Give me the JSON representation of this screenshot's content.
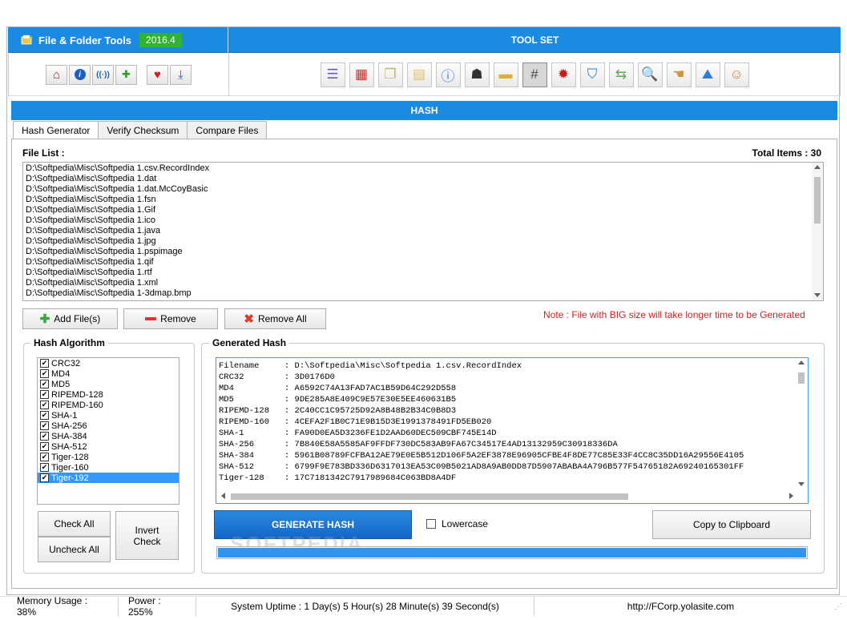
{
  "app": {
    "title": "File & Folder Tools",
    "version": "2016.4",
    "toolset_label": "TOOL SET",
    "colors": {
      "accent": "#1a8be0",
      "badge": "#31b331",
      "note": "#cc2222"
    }
  },
  "left_toolbar": [
    {
      "name": "home-icon",
      "glyph": "⌂",
      "color": "#b01818"
    },
    {
      "name": "info-icon",
      "glyph": "i",
      "color": "#1b5fc0"
    },
    {
      "name": "broadcast-icon",
      "glyph": "((·))",
      "color": "#1b5fc0"
    },
    {
      "name": "add-plus-icon",
      "glyph": "✚",
      "color": "#2f9a2f"
    },
    {
      "name": "heart-icon",
      "glyph": "♥",
      "color": "#d41c2c"
    },
    {
      "name": "download-icon",
      "glyph": "⤓",
      "color": "#1b5fc0"
    }
  ],
  "tool_icons": [
    {
      "name": "document-list-icon",
      "glyph": "☰",
      "color": "#6a58c8"
    },
    {
      "name": "calendar-icon",
      "glyph": "▦",
      "color": "#c83030"
    },
    {
      "name": "copy-pages-icon",
      "glyph": "❐",
      "color": "#c8b070"
    },
    {
      "name": "notepad-icon",
      "glyph": "▤",
      "color": "#e0c060"
    },
    {
      "name": "info-circle-icon",
      "glyph": "ⓘ",
      "color": "#2a7fd8"
    },
    {
      "name": "cat-robot-icon",
      "glyph": "☗",
      "color": "#333333"
    },
    {
      "name": "folder-icon",
      "glyph": "▬",
      "color": "#e0b030"
    },
    {
      "name": "hash-icon",
      "glyph": "#",
      "color": "#444444"
    },
    {
      "name": "virus-icon",
      "glyph": "✹",
      "color": "#c81818"
    },
    {
      "name": "shield-check-icon",
      "glyph": "⛉",
      "color": "#2a7fd8"
    },
    {
      "name": "file-convert-icon",
      "glyph": "⇆",
      "color": "#6aa060"
    },
    {
      "name": "search-icon",
      "glyph": "🔍",
      "color": "#1b5fc0"
    },
    {
      "name": "hand-money-icon",
      "glyph": "☚",
      "color": "#c89a40"
    },
    {
      "name": "image-chart-icon",
      "glyph": "⛰",
      "color": "#2a7fd8"
    },
    {
      "name": "user-lock-icon",
      "glyph": "☺",
      "color": "#c08030"
    }
  ],
  "hash_section": {
    "header": "HASH",
    "tabs": [
      "Hash Generator",
      "Verify Checksum",
      "Compare Files"
    ],
    "file_list_label": "File List :",
    "total_items": "Total Items : 30",
    "files": [
      "D:\\Softpedia\\Misc\\Softpedia 1.csv.RecordIndex",
      "D:\\Softpedia\\Misc\\Softpedia 1.dat",
      "D:\\Softpedia\\Misc\\Softpedia 1.dat.McCoyBasic",
      "D:\\Softpedia\\Misc\\Softpedia 1.fsn",
      "D:\\Softpedia\\Misc\\Softpedia 1.Gif",
      "D:\\Softpedia\\Misc\\Softpedia 1.ico",
      "D:\\Softpedia\\Misc\\Softpedia 1.java",
      "D:\\Softpedia\\Misc\\Softpedia 1.jpg",
      "D:\\Softpedia\\Misc\\Softpedia 1.pspimage",
      "D:\\Softpedia\\Misc\\Softpedia 1.qif",
      "D:\\Softpedia\\Misc\\Softpedia 1.rtf",
      "D:\\Softpedia\\Misc\\Softpedia 1.xml",
      "D:\\Softpedia\\Misc\\Softpedia 1-3dmap.bmp"
    ],
    "buttons": {
      "add_files": "Add File(s)",
      "remove": "Remove",
      "remove_all": "Remove All"
    },
    "note": "Note : File with BIG size will take longer time to be Generated",
    "algorithm_title": "Hash Algorithm",
    "algorithms": [
      {
        "label": "CRC32",
        "checked": true
      },
      {
        "label": "MD4",
        "checked": true
      },
      {
        "label": "MD5",
        "checked": true
      },
      {
        "label": "RIPEMD-128",
        "checked": true
      },
      {
        "label": "RIPEMD-160",
        "checked": true
      },
      {
        "label": "SHA-1",
        "checked": true
      },
      {
        "label": "SHA-256",
        "checked": true
      },
      {
        "label": "SHA-384",
        "checked": true
      },
      {
        "label": "SHA-512",
        "checked": true
      },
      {
        "label": "Tiger-128",
        "checked": true
      },
      {
        "label": "Tiger-160",
        "checked": true
      },
      {
        "label": "Tiger-192",
        "checked": true,
        "selected": true
      }
    ],
    "check_all": "Check All",
    "uncheck_all": "Uncheck All",
    "invert_check": "Invert Check",
    "generated_title": "Generated Hash",
    "generated_rows": [
      "Filename     : D:\\Softpedia\\Misc\\Softpedia 1.csv.RecordIndex",
      "CRC32        : 3D0176D0",
      "MD4          : A6592C74A13FAD7AC1B59D64C292D558",
      "MD5          : 9DE285A8E409C9E57E30E5EE460631B5",
      "RIPEMD-128   : 2C40CC1C95725D92A8B48B2B34C0B8D3",
      "RIPEMD-160   : 4CEFA2F1B0C71E9B15D3E1991378491FD5EB020",
      "SHA-1        : FA90D0EA5D3236FE1D2AAD60DEC509CBF745E14D",
      "SHA-256      : 7B840E58A5585AF9FFDF730DC583AB9FA67C34517E4AD13132959C30918336DA",
      "SHA-384      : 5961B08789FCFBA12AE79E0E5B512D106F5A2EF3878E96905CFBE4F8DE77C85E33F4CC8C35DD16A29556E4105",
      "SHA-512      : 6799F9E783BD336D6317013EA53C09B5021AD8A9AB0DD87D5907ABABA4A796B577F54765182A69240165301FF",
      "Tiger-128    : 17C7181342C7917989684C063BD8A4DF"
    ],
    "generate_button": "GENERATE HASH",
    "lowercase_label": "Lowercase",
    "copy_button": "Copy to Clipboard",
    "progress": 1.0,
    "watermark": "SOFTPEDIA"
  },
  "status": {
    "memory": "Memory Usage : 38%",
    "power": "Power : 255%",
    "uptime": "System Uptime : 1 Day(s) 5 Hour(s) 28 Minute(s) 39 Second(s)",
    "url": "http://FCorp.yolasite.com"
  }
}
